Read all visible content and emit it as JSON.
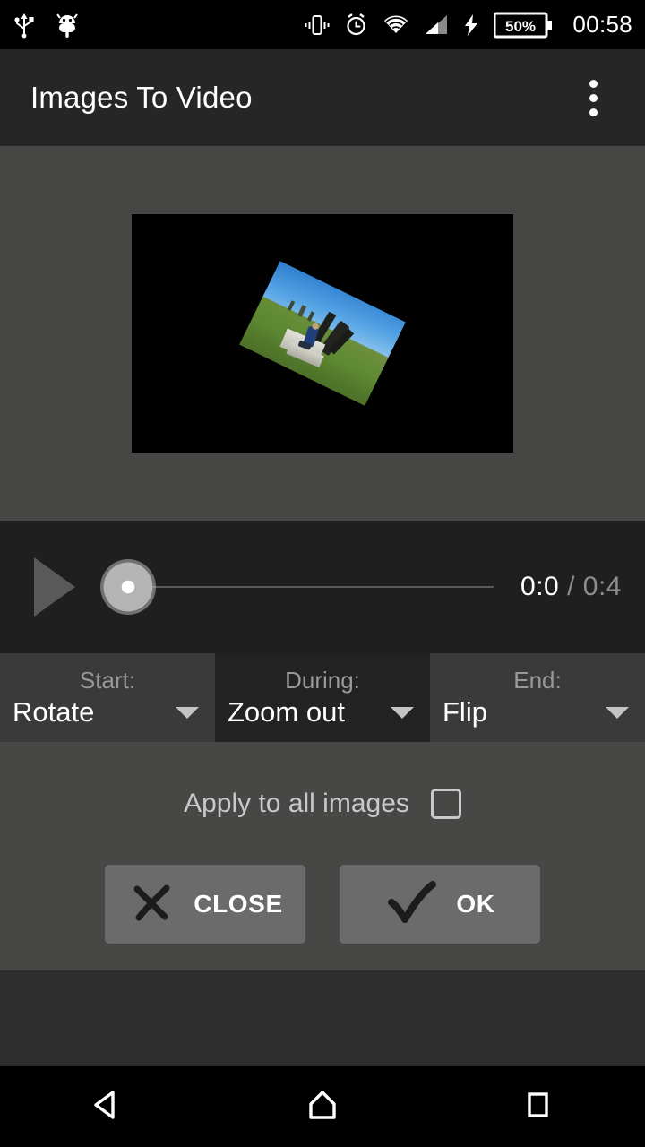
{
  "status_bar": {
    "icons": [
      "usb-icon",
      "android-debug-icon",
      "vibrate-icon",
      "alarm-icon",
      "wifi-icon",
      "cellular-signal-icon",
      "charging-bolt-icon"
    ],
    "battery_percent": "50%",
    "time": "00:58"
  },
  "app_bar": {
    "title": "Images To Video",
    "overflow": "overflow-menu-icon"
  },
  "preview": {
    "canvas_background": "#000000",
    "image_description": "rotated landscape photo"
  },
  "player": {
    "play_label": "play-icon",
    "current_time": "0:0",
    "separator": "/",
    "total_time": "0:4",
    "seek_position_percent": 0
  },
  "spinners": [
    {
      "label": "Start:",
      "value": "Rotate",
      "focused": false
    },
    {
      "label": "During:",
      "value": "Zoom out",
      "focused": true
    },
    {
      "label": "End:",
      "value": "Flip",
      "focused": false
    }
  ],
  "apply_all": {
    "label": "Apply to all images",
    "checked": false
  },
  "buttons": {
    "close": "CLOSE",
    "ok": "OK"
  },
  "nav_bar": {
    "back": "back-icon",
    "home": "home-icon",
    "recents": "recents-icon"
  },
  "colors": {
    "background": "#474745",
    "app_bar": "#262626",
    "player_bar": "#1f1f1f",
    "spinner": "#3a3a3a",
    "spinner_focused": "#232323",
    "button": "#6b6b6b",
    "accent_text": "#ffffff"
  }
}
